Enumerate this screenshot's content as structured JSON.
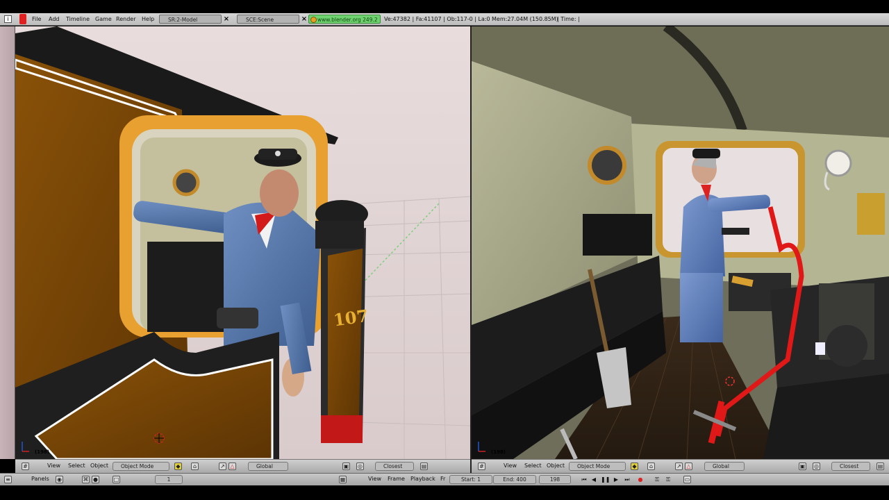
{
  "topbar": {
    "menus": [
      "File",
      "Add",
      "Timeline",
      "Game",
      "Render",
      "Help"
    ],
    "screen": "SR:2-Model",
    "scene": "SCE:Scene",
    "url": "www.blender.org 249.2",
    "stats": "Ve:47382 | Fa:41107 | Ob:117-0 | La:0",
    "mem": "Mem:27.04M (150.85M)",
    "time": "| Time: |"
  },
  "viewport_left": {
    "frame": "(198)"
  },
  "viewport_right": {
    "frame": "(198)"
  },
  "header_left": {
    "menus": [
      "View",
      "Select",
      "Object"
    ],
    "mode": "Object Mode",
    "orientation": "Global",
    "snap": "Closest"
  },
  "header_right": {
    "menus": [
      "View",
      "Select",
      "Object"
    ],
    "mode": "Object Mode",
    "orientation": "Global",
    "snap": "Closest"
  },
  "timeline": {
    "panels": "Panels",
    "panel_value": "1",
    "menus": [
      "View",
      "Frame",
      "Playback"
    ],
    "start": "Start: 1",
    "end": "End: 400",
    "current": "198",
    "fr": "Fr"
  },
  "scene_labels": {
    "engine_number": "107"
  }
}
